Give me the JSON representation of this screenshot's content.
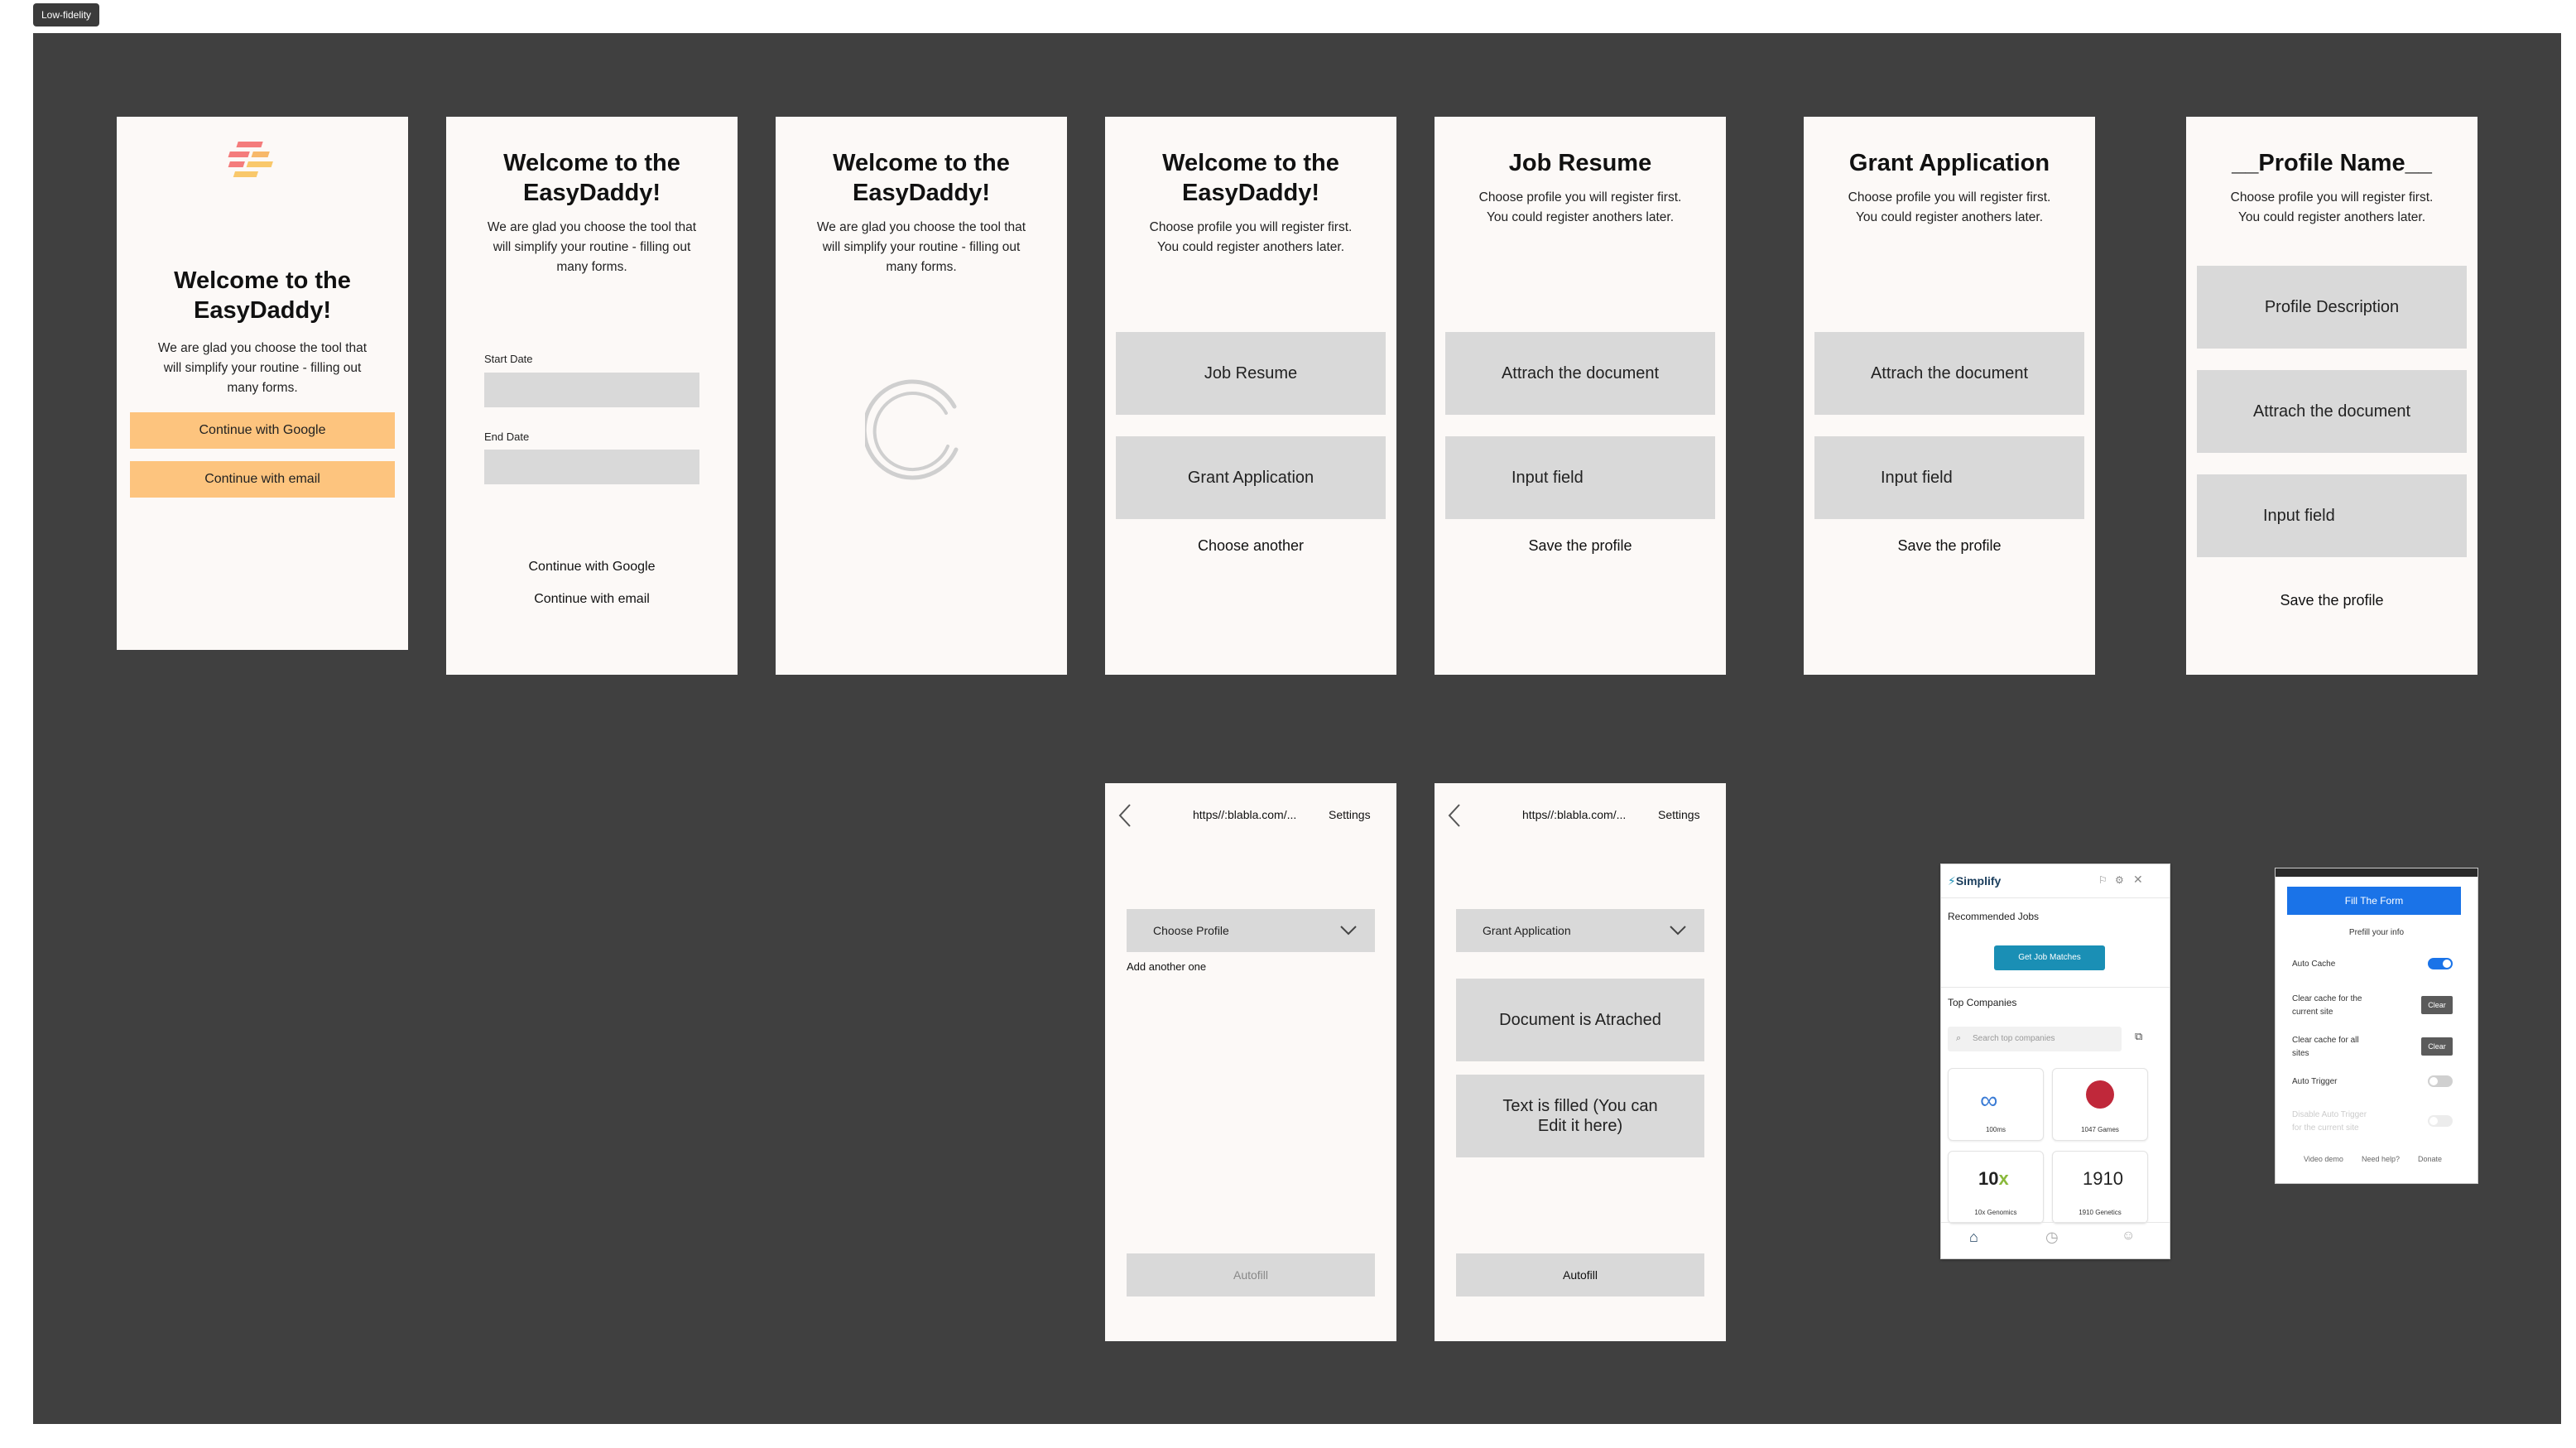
{
  "frame_label": "Low-fidelity",
  "screen1": {
    "title_line1": "Welcome to the",
    "title_line2": "EasyDaddy!",
    "desc": [
      "We are glad you choose the tool that",
      "will simplify your routine - filling out",
      "many forms."
    ],
    "btn_google": "Continue with Google",
    "btn_email": "Continue with email"
  },
  "screen2": {
    "title_line1": "Welcome to the",
    "title_line2": "EasyDaddy!",
    "desc": [
      "We are glad you choose the tool that",
      "will simplify your routine - filling out",
      "many forms."
    ],
    "start_label": "Start Date",
    "end_label": "End Date",
    "link_google": "Continue with Google",
    "link_email": "Continue with email"
  },
  "screen3": {
    "title_line1": "Welcome to the",
    "title_line2": "EasyDaddy!",
    "desc": [
      "We are glad you choose the tool that",
      "will simplify your routine - filling out",
      "many forms."
    ]
  },
  "screen4": {
    "title_line1": "Welcome to the",
    "title_line2": "EasyDaddy!",
    "desc": [
      "Choose profile you will register first.",
      "You could register anothers later."
    ],
    "btn1": "Job Resume",
    "btn2": "Grant Application",
    "link": "Choose another"
  },
  "screen5": {
    "title": "Job Resume",
    "desc": [
      "Choose profile you will register first.",
      "You could register anothers later."
    ],
    "btn1": "Attrach the document",
    "btn2": "Input field",
    "link": "Save the profile"
  },
  "screen6": {
    "title": "Grant Application",
    "desc": [
      "Choose profile you will register first.",
      "You could register anothers later."
    ],
    "btn1": "Attrach the document",
    "btn2": "Input field",
    "link": "Save the profile"
  },
  "screen7": {
    "title": "__Profile Name__",
    "desc": [
      "Choose profile you will register first.",
      "You could register anothers later."
    ],
    "btn1": "Profile Description",
    "btn2": "Attrach the document",
    "btn3": "Input field",
    "link": "Save the profile"
  },
  "screen8": {
    "url": "https//:blabla.com/...",
    "settings": "Settings",
    "dropdown": "Choose Profile",
    "add_another": "Add another one",
    "autofill": "Autofill"
  },
  "screen9": {
    "url": "https//:blabla.com/...",
    "settings": "Settings",
    "dropdown": "Grant Application",
    "doc_status": "Document is Atrached",
    "text_status_line1": "Text is filled (You can",
    "text_status_line2": "Edit it here)",
    "autofill": "Autofill"
  },
  "simplify": {
    "brand": "Simplify",
    "recommended": "Recommended Jobs",
    "get_matches": "Get Job Matches",
    "top_companies": "Top Companies",
    "search_placeholder": "Search top companies",
    "companies": [
      "100ms",
      "1047 Games",
      "10x Genomics",
      "1910 Genetics"
    ],
    "accent": "#1a8fb5"
  },
  "fill_panel": {
    "fill_button": "Fill The Form",
    "prefill": "Prefill your info",
    "auto_cache": "Auto Cache",
    "clear_site": [
      "Clear cache for the",
      "current site"
    ],
    "clear_all": [
      "Clear cache for all",
      "sites"
    ],
    "clear_label": "Clear",
    "auto_trigger": "Auto Trigger",
    "disable_auto": [
      "Disable Auto Trigger",
      "for the current site"
    ],
    "footer": [
      "Video demo",
      "Need help?",
      "Donate"
    ],
    "accent": "#1a73e8"
  },
  "colors": {
    "canvas": "#404040",
    "screen_bg": "#fcf9f7",
    "cta": "#fdc47e",
    "block": "#d9d9d9"
  }
}
